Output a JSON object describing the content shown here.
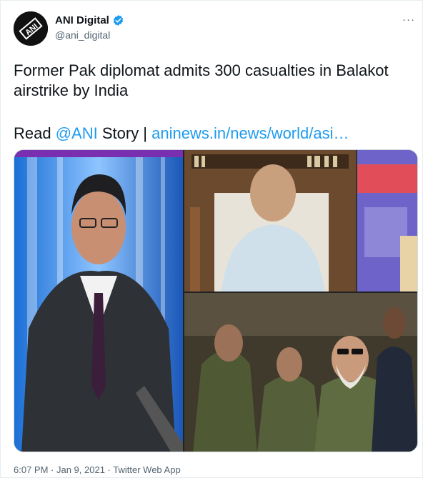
{
  "account": {
    "display_name": "ANI Digital",
    "handle": "@ani_digital",
    "avatar_text": "ANI"
  },
  "more_label": "···",
  "tweet": {
    "text": "Former Pak diplomat admits 300 casualties in Balakot airstrike by India",
    "read_prefix": "Read ",
    "mention": "@ANI",
    "story_word": " Story | ",
    "link_text": "aninews.in/news/world/asi…"
  },
  "media": {
    "description_icon": "news-collage-image"
  },
  "footer": {
    "time": "6:07 PM",
    "sep1": " · ",
    "date": "Jan 9, 2021",
    "sep2": " · ",
    "source": "Twitter Web App"
  },
  "colors": {
    "link": "#1d9bf0",
    "verified": "#1d9bf0",
    "text": "#0f1419",
    "muted": "#536471"
  }
}
